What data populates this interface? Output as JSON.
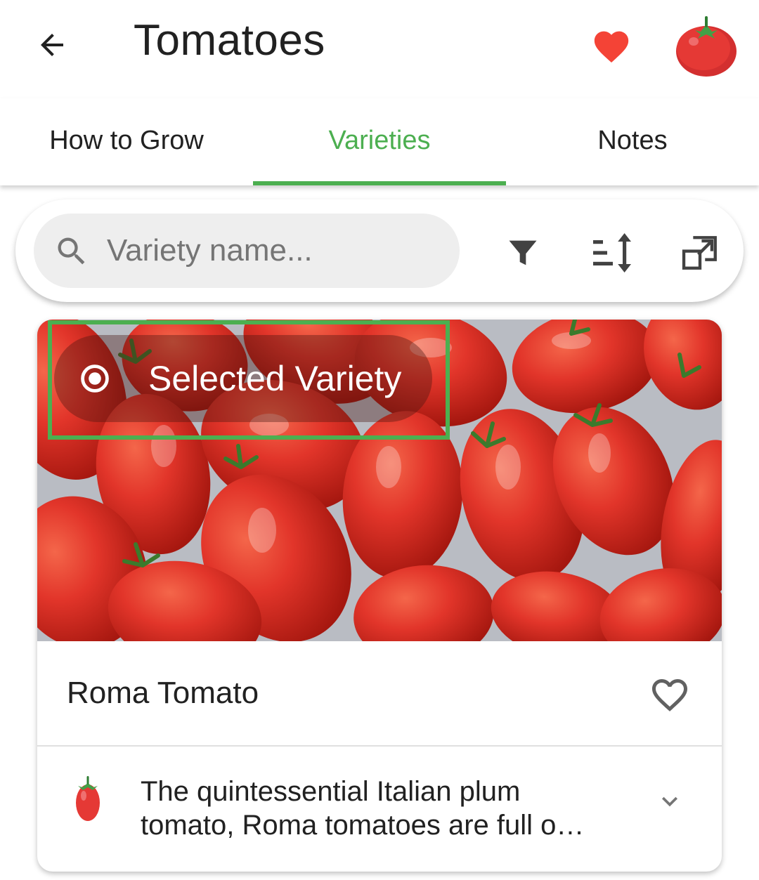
{
  "appbar": {
    "title": "Tomatoes",
    "back_icon": "arrow-back-icon",
    "favorite_icon": "heart-filled-icon",
    "avatar_icon": "tomato-icon"
  },
  "tabs": [
    {
      "label": "How to Grow",
      "selected": false
    },
    {
      "label": "Varieties",
      "selected": true
    },
    {
      "label": "Notes",
      "selected": false
    }
  ],
  "search": {
    "placeholder": "Variety name...",
    "value": "",
    "tools": [
      "filter-icon",
      "sort-icon",
      "open-in-new-icon"
    ]
  },
  "variety_card": {
    "badge_label": "Selected Variety",
    "name": "Roma Tomato",
    "description_line1": "The quintessential Italian plum",
    "description_line2": "tomato, Roma tomatoes are full o…",
    "favorite_icon": "heart-outline-icon",
    "expand_icon": "chevron-down-icon",
    "type_icon": "plum-tomato-icon"
  },
  "colors": {
    "accent": "#4caf50",
    "heart": "#f44336",
    "tomato": "#e53935"
  }
}
